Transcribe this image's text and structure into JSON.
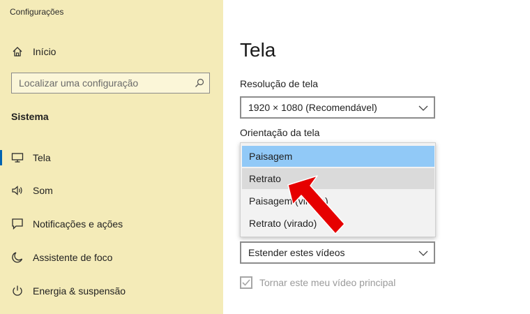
{
  "window": {
    "title": "Configurações"
  },
  "sidebar": {
    "home_label": "Início",
    "search_placeholder": "Localizar uma configuração",
    "section_title": "Sistema",
    "items": [
      {
        "label": "Tela",
        "icon": "monitor-icon",
        "selected": true
      },
      {
        "label": "Som",
        "icon": "speaker-icon",
        "selected": false
      },
      {
        "label": "Notificações e ações",
        "icon": "notification-icon",
        "selected": false
      },
      {
        "label": "Assistente de foco",
        "icon": "moon-icon",
        "selected": false
      },
      {
        "label": "Energia & suspensão",
        "icon": "power-icon",
        "selected": false
      }
    ]
  },
  "main": {
    "title": "Tela",
    "resolution": {
      "label": "Resolução de tela",
      "value": "1920 × 1080 (Recomendável)"
    },
    "orientation": {
      "label": "Orientação da tela",
      "options": [
        {
          "label": "Paisagem",
          "state": "selected"
        },
        {
          "label": "Retrato",
          "state": "hover"
        },
        {
          "label": "Paisagem (virado)",
          "state": "normal"
        },
        {
          "label": "Retrato (virado)",
          "state": "normal"
        }
      ]
    },
    "multiple_displays": {
      "value": "Estender estes vídeos"
    },
    "primary_checkbox": {
      "label": "Tornar este meu vídeo principal",
      "checked": true,
      "disabled": true
    }
  },
  "annotation": {
    "arrow_color": "#e60000",
    "arrow_target": "Retrato"
  },
  "colors": {
    "sidebar_bg": "#f4ebb8",
    "accent": "#0063b1",
    "selected_option": "#91c9f7",
    "hover_option": "#dadada"
  }
}
